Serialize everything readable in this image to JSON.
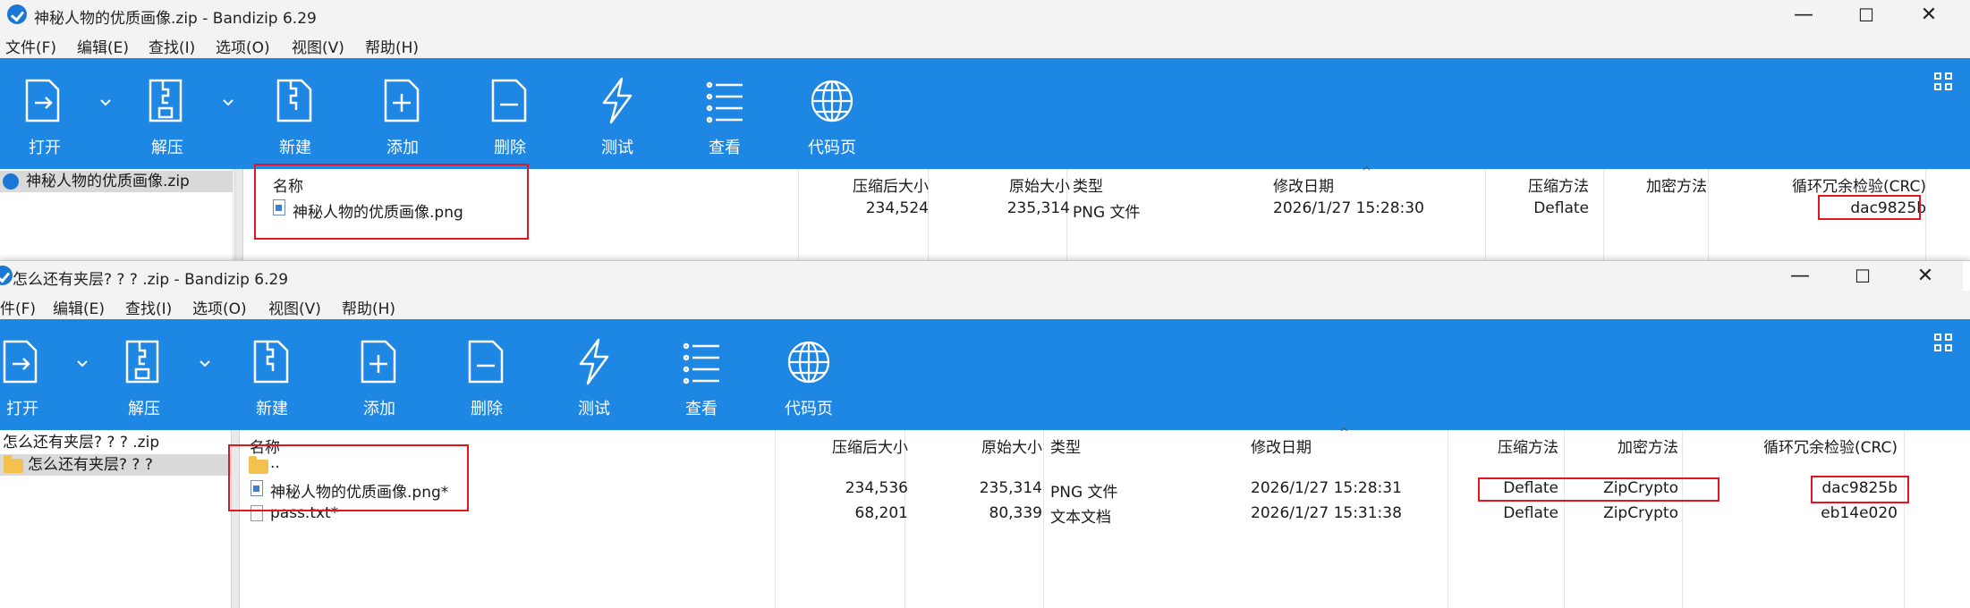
{
  "windows": [
    {
      "title": "神秘人物的优质画像.zip - Bandizip 6.29",
      "menu": [
        "文件(F)",
        "编辑(E)",
        "查找(I)",
        "选项(O)",
        "视图(V)",
        "帮助(H)"
      ],
      "toolbar": [
        "打开",
        "解压",
        "新建",
        "添加",
        "删除",
        "测试",
        "查看",
        "代码页"
      ],
      "tree": [
        "神秘人物的优质画像.zip"
      ],
      "columns": [
        "名称",
        "压缩后大小",
        "原始大小",
        "类型",
        "修改日期",
        "压缩方法",
        "加密方法",
        "循环冗余检验(CRC)"
      ],
      "rows": [
        {
          "name": "神秘人物的优质画像.png",
          "packed": "234,524",
          "size": "235,314",
          "type": "PNG 文件",
          "modified": "2026/1/27 15:28:30",
          "method": "Deflate",
          "encryption": "",
          "crc": "dac9825b"
        }
      ]
    },
    {
      "title": "怎么还有夹层? ? ? .zip - Bandizip 6.29",
      "menu": [
        "件(F)",
        "编辑(E)",
        "查找(I)",
        "选项(O)",
        "视图(V)",
        "帮助(H)"
      ],
      "toolbar": [
        "打开",
        "解压",
        "新建",
        "添加",
        "删除",
        "测试",
        "查看",
        "代码页"
      ],
      "tree": [
        "怎么还有夹层? ? ? .zip",
        "怎么还有夹层? ? ?"
      ],
      "columns": [
        "名称",
        "压缩后大小",
        "原始大小",
        "类型",
        "修改日期",
        "压缩方法",
        "加密方法",
        "循环冗余检验(CRC)"
      ],
      "rows": [
        {
          "name": "..",
          "packed": "",
          "size": "",
          "type": "",
          "modified": "",
          "method": "",
          "encryption": "",
          "crc": ""
        },
        {
          "name": "神秘人物的优质画像.png*",
          "packed": "234,536",
          "size": "235,314",
          "type": "PNG 文件",
          "modified": "2026/1/27 15:28:31",
          "method": "Deflate",
          "encryption": "ZipCrypto",
          "crc": "dac9825b"
        },
        {
          "name": "pass.txt*",
          "packed": "68,201",
          "size": "80,339",
          "type": "文本文档",
          "modified": "2026/1/27 15:31:38",
          "method": "Deflate",
          "encryption": "ZipCrypto",
          "crc": "eb14e020"
        }
      ]
    }
  ],
  "window_buttons": {
    "minimize": "—",
    "maximize": "☐",
    "close": "✕"
  },
  "colors": {
    "toolbar_bg": "#1e86e3",
    "highlight_red": "#e0171f",
    "tree_selected": "#d9d9d9"
  }
}
